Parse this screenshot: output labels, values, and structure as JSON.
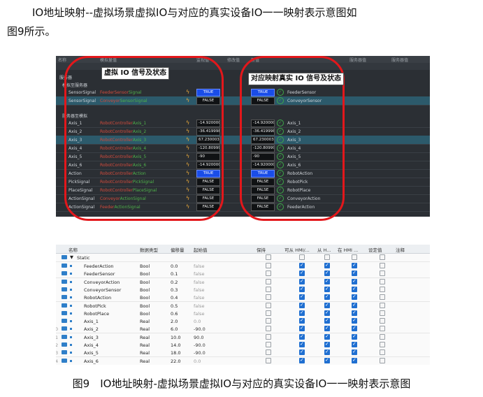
{
  "text": {
    "paragraph_line1": "IO地址映射--虚拟场景虚拟IO与对应的真实设备IO一一映射表示意图如",
    "paragraph_line2": "图9所示。",
    "caption": "图9　IO地址映射-虚拟场景虚拟IO与对应的真实设备IO一一映射表示意图"
  },
  "overlay": {
    "left_label": "虚拟 IO 信号及状态",
    "right_label": "对应映射真实 IO 信号及状态",
    "oval_color": "#e3171b"
  },
  "dark_table": {
    "header_left": "名称",
    "header_source": "模拟量值",
    "header_value": "监视值",
    "header_edit": "修改值",
    "header_new": "新值",
    "header_right": "服务器值",
    "header_right2": "服务器值",
    "group_server": "服务器",
    "group_sim": "模拟至服务器",
    "group_sim2": "服务器至模拟",
    "rows": [
      {
        "name": "SensorSignal",
        "src_a": "FeederSensor",
        "src_b": "Signal",
        "v1": "TRUE",
        "v1_on": true,
        "v2": "TRUE",
        "v2_on": true,
        "target": "FeederSensor",
        "sel": false
      },
      {
        "name": "SensorSignal",
        "src_a": "Conveyor",
        "src_b": "SensorSignal",
        "v1": "FALSE",
        "v1_on": false,
        "v2": "FALSE",
        "v2_on": false,
        "target": "ConveyorSensor",
        "sel": true
      },
      {
        "name": "Axis_1",
        "src_a": "RobotController",
        "src_b": "Axis_1",
        "v1": "-14.9200000",
        "v1_on": false,
        "v2": "-14.9200000",
        "v2_on": false,
        "target": "Axis_1",
        "sel": false
      },
      {
        "name": "Axis_2",
        "src_a": "RobotController",
        "src_b": "Axis_2",
        "v1": "-36.4199981",
        "v1_on": false,
        "v2": "-36.4199981",
        "v2_on": false,
        "target": "Axis_2",
        "sel": false
      },
      {
        "name": "Axis_3",
        "src_a": "RobotController",
        "src_b": "Axis_3",
        "v1": "67.23000335",
        "v1_on": false,
        "v2": "67.23000335",
        "v2_on": false,
        "target": "Axis_3",
        "sel": true
      },
      {
        "name": "Axis_4",
        "src_a": "RobotController",
        "src_b": "Axis_4",
        "v1": "-120.809997",
        "v1_on": false,
        "v2": "-120.809997",
        "v2_on": false,
        "target": "Axis_4",
        "sel": false
      },
      {
        "name": "Axis_5",
        "src_a": "RobotController",
        "src_b": "Axis_5",
        "v1": "-90",
        "v1_on": false,
        "v2": "-90",
        "v2_on": false,
        "target": "Axis_5",
        "sel": false
      },
      {
        "name": "Axis_6",
        "src_a": "RobotController",
        "src_b": "Axis_6",
        "v1": "-14.9200000",
        "v1_on": false,
        "v2": "-14.9200000",
        "v2_on": false,
        "target": "Axis_6",
        "sel": false
      },
      {
        "name": "Action",
        "src_a": "RobotController",
        "src_b": "Action",
        "v1": "TRUE",
        "v1_on": true,
        "v2": "TRUE",
        "v2_on": true,
        "target": "RobotAction",
        "sel": false
      },
      {
        "name": "PickSignal",
        "src_a": "RobotController",
        "src_b": "PickSignal",
        "v1": "FALSE",
        "v1_on": false,
        "v2": "FALSE",
        "v2_on": false,
        "target": "RobotPick",
        "sel": false
      },
      {
        "name": "PlaceSignal",
        "src_a": "RobotController",
        "src_b": "PlaceSignal",
        "v1": "FALSE",
        "v1_on": false,
        "v2": "FALSE",
        "v2_on": false,
        "target": "RobotPlace",
        "sel": false
      },
      {
        "name": "ActionSignal",
        "src_a": "Conveyor",
        "src_b": "ActionSignal",
        "v1": "FALSE",
        "v1_on": false,
        "v2": "FALSE",
        "v2_on": false,
        "target": "ConveyorAction",
        "sel": false
      },
      {
        "name": "ActionSignal",
        "src_a": "Feeder",
        "src_b": "ActionSignal",
        "v1": "FALSE",
        "v1_on": false,
        "v2": "FALSE",
        "v2_on": false,
        "target": "FeederAction",
        "sel": false
      }
    ]
  },
  "light_table": {
    "headers": [
      "名称",
      "数据类型",
      "偏移量",
      "起始值",
      "保持",
      "可从 HMI/...",
      "从 H...",
      "在 HMI ...",
      "设定值",
      "注释"
    ],
    "group": "Static",
    "rows": [
      {
        "num": "",
        "name": "FeederAction",
        "type": "Bool",
        "offset": "0.0",
        "init": "false",
        "hmi1": true,
        "hmi2": true,
        "hmi3": true
      },
      {
        "num": "",
        "name": "FeederSensor",
        "type": "Bool",
        "offset": "0.1",
        "init": "false",
        "hmi1": true,
        "hmi2": true,
        "hmi3": true
      },
      {
        "num": "",
        "name": "ConveyorAction",
        "type": "Bool",
        "offset": "0.2",
        "init": "false",
        "hmi1": true,
        "hmi2": true,
        "hmi3": true
      },
      {
        "num": "",
        "name": "ConveyorSensor",
        "type": "Bool",
        "offset": "0.3",
        "init": "false",
        "hmi1": true,
        "hmi2": true,
        "hmi3": true
      },
      {
        "num": "",
        "name": "RobotAction",
        "type": "Bool",
        "offset": "0.4",
        "init": "false",
        "hmi1": true,
        "hmi2": true,
        "hmi3": true
      },
      {
        "num": "",
        "name": "RobotPick",
        "type": "Bool",
        "offset": "0.5",
        "init": "false",
        "hmi1": true,
        "hmi2": true,
        "hmi3": true
      },
      {
        "num": "",
        "name": "RobotPlace",
        "type": "Bool",
        "offset": "0.6",
        "init": "false",
        "hmi1": true,
        "hmi2": true,
        "hmi3": true
      },
      {
        "num": "",
        "name": "Axis_1",
        "type": "Real",
        "offset": "2.0",
        "init": "0.0",
        "hmi1": true,
        "hmi2": true,
        "hmi3": true
      },
      {
        "num": "0",
        "name": "Axis_2",
        "type": "Real",
        "offset": "6.0",
        "init": "-90.0",
        "hmi1": true,
        "hmi2": true,
        "hmi3": true
      },
      {
        "num": "1",
        "name": "Axis_3",
        "type": "Real",
        "offset": "10.0",
        "init": "90.0",
        "hmi1": true,
        "hmi2": true,
        "hmi3": true
      },
      {
        "num": "2",
        "name": "Axis_4",
        "type": "Real",
        "offset": "14.0",
        "init": "-90.0",
        "hmi1": true,
        "hmi2": true,
        "hmi3": true
      },
      {
        "num": "3",
        "name": "Axis_5",
        "type": "Real",
        "offset": "18.0",
        "init": "-90.0",
        "hmi1": true,
        "hmi2": true,
        "hmi3": true
      },
      {
        "num": "4",
        "name": "Axis_6",
        "type": "Real",
        "offset": "22.0",
        "init": "0.0",
        "hmi1": true,
        "hmi2": true,
        "hmi3": true
      }
    ]
  }
}
